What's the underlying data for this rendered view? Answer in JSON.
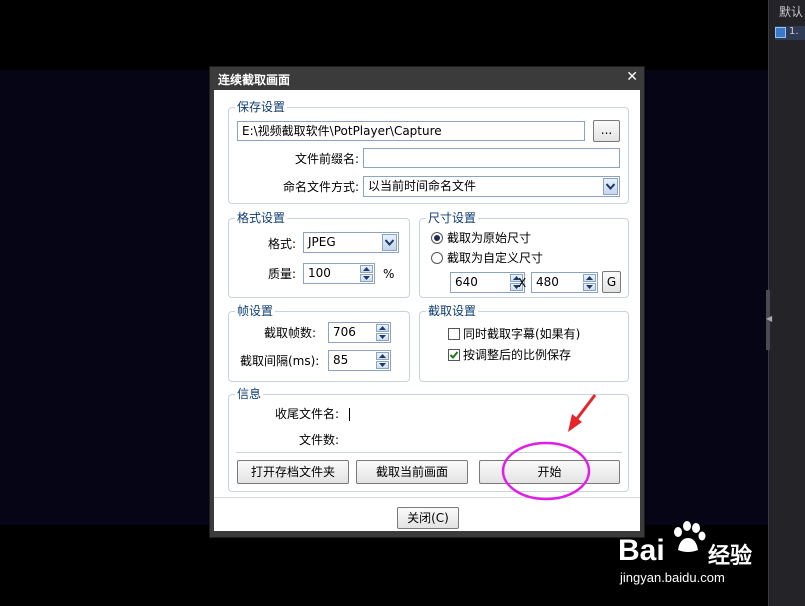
{
  "right_panel": {
    "title": "默认",
    "row_text": "1."
  },
  "dialog": {
    "title": "连续截取画面",
    "close_symbol": "✕",
    "save_group": {
      "legend": "保存设置",
      "path_value": "E:\\视频截取软件\\PotPlayer\\Capture",
      "browse_label": "...",
      "prefix_label": "文件前缀名:",
      "prefix_value": "",
      "naming_label": "命名文件方式:",
      "naming_value": "以当前时间命名文件"
    },
    "format_group": {
      "legend": "格式设置",
      "format_label": "格式:",
      "format_value": "JPEG",
      "quality_label": "质量:",
      "quality_value": "100",
      "quality_unit": "%"
    },
    "size_group": {
      "legend": "尺寸设置",
      "original_label": "截取为原始尺寸",
      "original_selected": true,
      "custom_label": "截取为自定义尺寸",
      "custom_selected": false,
      "width_value": "640",
      "times_label": "X",
      "height_value": "480",
      "g_label": "G"
    },
    "frame_group": {
      "legend": "帧设置",
      "count_label": "截取帧数:",
      "count_value": "706",
      "interval_label": "截取间隔(ms):",
      "interval_value": "85"
    },
    "capture_group": {
      "legend": "截取设置",
      "subtitle_label": "同时截取字幕(如果有)",
      "subtitle_checked": false,
      "ratio_label": "按调整后的比例保存",
      "ratio_checked": true
    },
    "info_group": {
      "legend": "信息",
      "last_file_label": "收尾文件名:",
      "last_file_value": "",
      "file_count_label": "文件数:",
      "file_count_value": ""
    },
    "buttons": {
      "open_folder": "打开存档文件夹",
      "capture_current": "截取当前画面",
      "start": "开始",
      "close": "关闭(C)"
    }
  },
  "watermark": {
    "brand": "Bai",
    "brand_suffix": "经验",
    "url": "jingyan.baidu.com"
  },
  "colors": {
    "annotation": "#e01ee8",
    "arrow": "#e8242a",
    "legend_text": "#0f3d74",
    "group_border": "#c9d3df"
  }
}
